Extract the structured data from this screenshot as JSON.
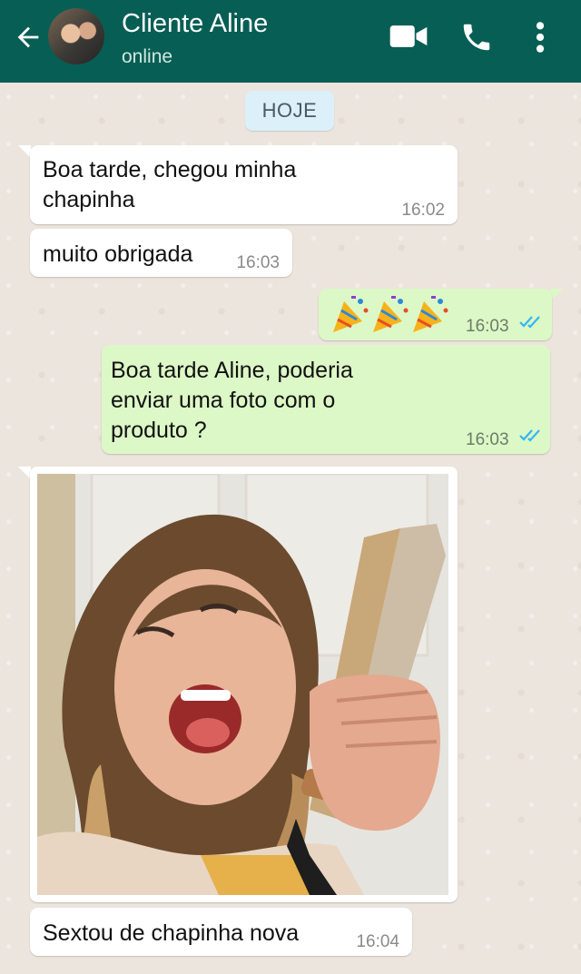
{
  "header": {
    "contact_name": "Cliente Aline",
    "status": "online",
    "icons": [
      "back-arrow-icon",
      "video-call-icon",
      "phone-icon",
      "more-vert-icon"
    ]
  },
  "date_chip": "HOJE",
  "messages": [
    {
      "direction": "in",
      "text_lines": [
        "Boa tarde, chegou minha",
        "chapinha"
      ],
      "time": "16:02"
    },
    {
      "direction": "in",
      "text_lines": [
        "muito obrigada"
      ],
      "time": "16:03"
    },
    {
      "direction": "out",
      "emoji": "🎉🎉🎉",
      "time": "16:03",
      "status": "read"
    },
    {
      "direction": "out",
      "text_lines": [
        "Boa tarde Aline, poderia",
        "enviar uma foto com o",
        "produto ?"
      ],
      "time": "16:03",
      "status": "read"
    },
    {
      "direction": "in",
      "type": "image",
      "image_description": "photo"
    },
    {
      "direction": "in",
      "text_lines": [
        "Sextou de chapinha nova"
      ],
      "time": "16:04"
    }
  ],
  "colors": {
    "header": "#075e54",
    "incoming_bubble": "#ffffff",
    "outgoing_bubble": "#dcf8c6",
    "read_ticks": "#34b7f1",
    "date_chip": "#dbf0f9"
  }
}
